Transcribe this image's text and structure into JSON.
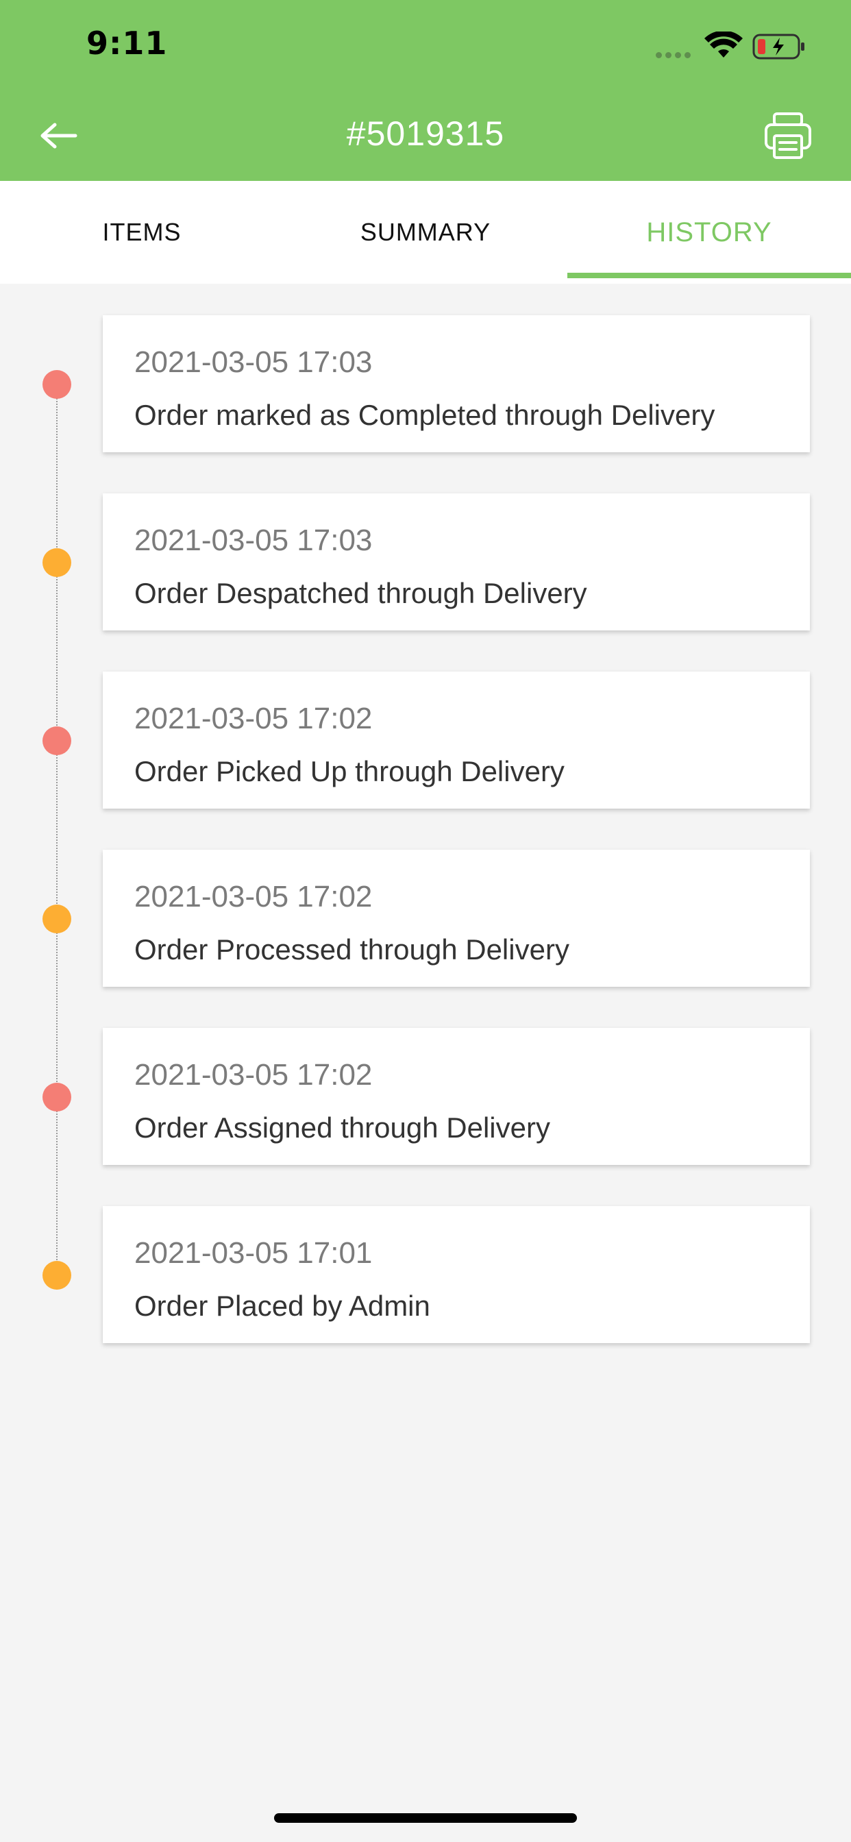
{
  "status_bar": {
    "time": "9:11"
  },
  "header": {
    "title": "#5019315",
    "back_icon": "arrow-left-icon",
    "print_icon": "printer-icon"
  },
  "tabs": [
    {
      "label": "ITEMS",
      "active": false
    },
    {
      "label": "SUMMARY",
      "active": false
    },
    {
      "label": "HISTORY",
      "active": true
    }
  ],
  "history": [
    {
      "time": "2021-03-05 17:03",
      "text": "Order marked as Completed through Delivery",
      "dot_color": "#f47e75"
    },
    {
      "time": "2021-03-05 17:03",
      "text": "Order Despatched through Delivery",
      "dot_color": "#fdae33"
    },
    {
      "time": "2021-03-05 17:02",
      "text": "Order Picked Up through Delivery",
      "dot_color": "#f47e75"
    },
    {
      "time": "2021-03-05 17:02",
      "text": "Order Processed through Delivery",
      "dot_color": "#fdae33"
    },
    {
      "time": "2021-03-05 17:02",
      "text": "Order Assigned through Delivery",
      "dot_color": "#f47e75"
    },
    {
      "time": "2021-03-05 17:01",
      "text": "Order Placed by Admin",
      "dot_color": "#fdae33"
    }
  ],
  "colors": {
    "brand": "#7ec863",
    "background": "#f4f4f4",
    "dot_red": "#f47e75",
    "dot_orange": "#fdae33"
  }
}
